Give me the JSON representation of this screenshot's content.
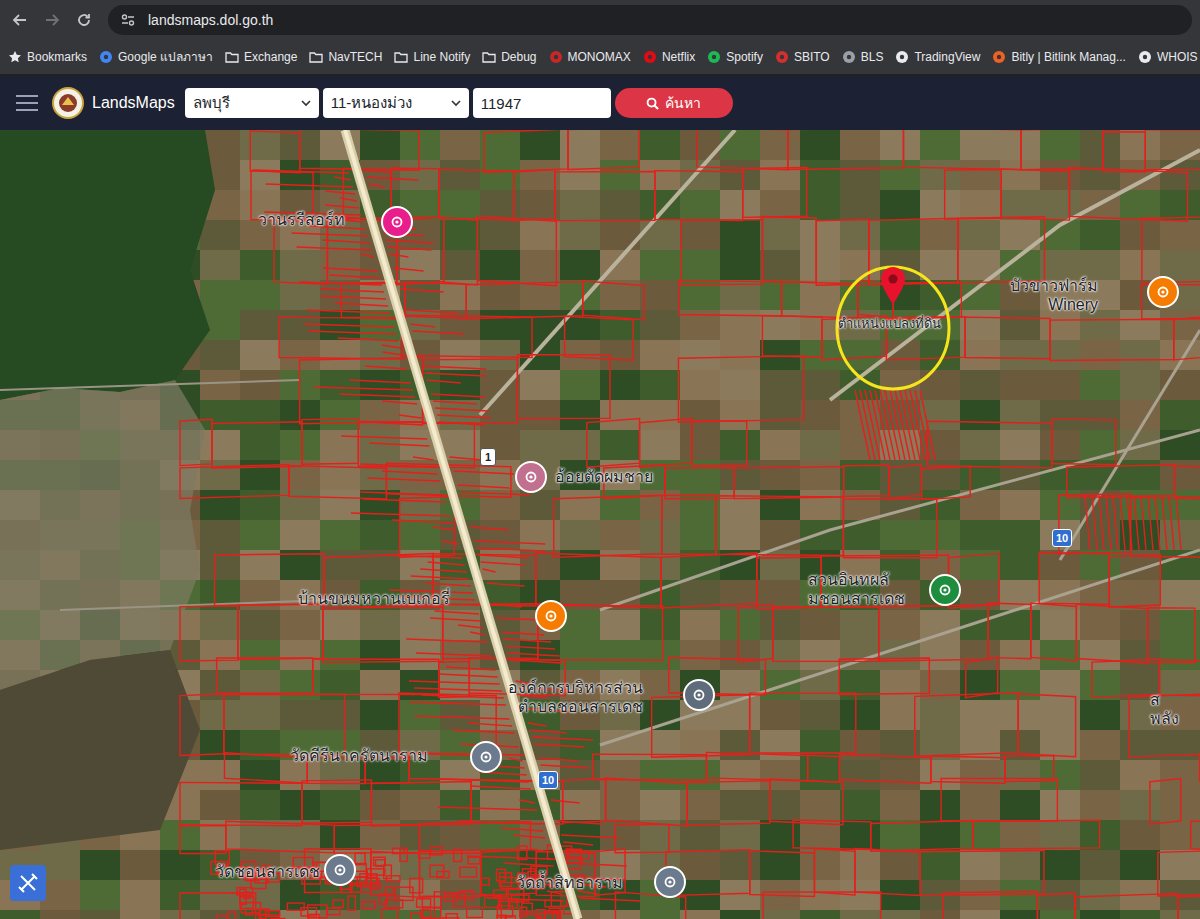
{
  "browser": {
    "url": "landsmaps.dol.go.th"
  },
  "bookmarks": [
    {
      "label": "Bookmarks",
      "kind": "star",
      "color": "#e8eaed"
    },
    {
      "label": "Google แปลภาษา",
      "kind": "site",
      "color": "#4285f4"
    },
    {
      "label": "Exchange",
      "kind": "folder",
      "color": "#e8eaed"
    },
    {
      "label": "NavTECH",
      "kind": "folder",
      "color": "#e8eaed"
    },
    {
      "label": "Line Notify",
      "kind": "folder",
      "color": "#e8eaed"
    },
    {
      "label": "Debug",
      "kind": "folder",
      "color": "#e8eaed"
    },
    {
      "label": "MONOMAX",
      "kind": "site",
      "color": "#c62828"
    },
    {
      "label": "Netflix",
      "kind": "site",
      "color": "#e50914"
    },
    {
      "label": "Spotify",
      "kind": "site",
      "color": "#1db954"
    },
    {
      "label": "SBITO",
      "kind": "site",
      "color": "#d32f2f"
    },
    {
      "label": "BLS",
      "kind": "site",
      "color": "#9aa0a6"
    },
    {
      "label": "TradingView",
      "kind": "site",
      "color": "#e8eaed"
    },
    {
      "label": "Bitly | Bitlink Manag...",
      "kind": "site",
      "color": "#ee6123"
    },
    {
      "label": "WHOIS",
      "kind": "site",
      "color": "#e8eaed"
    }
  ],
  "app": {
    "title": "LandsMaps",
    "province": "ลพบุรี",
    "district": "11-หนองม่วง",
    "parcel": "11947",
    "search_button": "ค้นหา"
  },
  "map": {
    "places": [
      {
        "kind": "pin",
        "lines": [
          "วานรรีสอร์ท"
        ],
        "color": "#e91e8c"
      },
      {
        "kind": "marker",
        "lines": [
          "ตำแหน่งแปลงที่ดิน"
        ],
        "color": "#e8122d"
      },
      {
        "kind": "pin",
        "lines": [
          "บัวขาวฟาร์ม",
          "Winery"
        ],
        "color": "#f57c00"
      },
      {
        "kind": "pin",
        "lines": [
          "อ้อยตัดผมชาย"
        ],
        "color": "#c2708f"
      },
      {
        "kind": "pin",
        "lines": [
          "บ้านขนมหวานเบเกอรี่"
        ],
        "color": "#f57c00"
      },
      {
        "kind": "pin",
        "lines": [
          "องค์การบริหารส่วน",
          "ตำบลชอนสารเดช"
        ],
        "color": "#5f6c7b"
      },
      {
        "kind": "pin",
        "lines": [
          "สวนอินทผลั",
          "มชอนสารเดช"
        ],
        "color": "#1e8e3e"
      },
      {
        "kind": "pin",
        "lines": [
          "วัดคีรีนาครัตนาราม"
        ],
        "color": "#6b7a8c"
      },
      {
        "kind": "pin",
        "lines": [
          "วัดชอนสารเดช"
        ],
        "color": "#6b7a8c"
      },
      {
        "kind": "pin",
        "lines": [
          "วัดถ้ำสิทธาราม"
        ],
        "color": "#6b7a8c"
      },
      {
        "kind": "label",
        "lines": [
          "ส",
          "พลัง"
        ],
        "color": "#202124"
      }
    ],
    "shields": [
      {
        "label": "1",
        "color": "#ffffff"
      },
      {
        "label": "10",
        "color": "#2f6fcf"
      },
      {
        "label": "10",
        "color": "#2f6fcf"
      }
    ]
  }
}
